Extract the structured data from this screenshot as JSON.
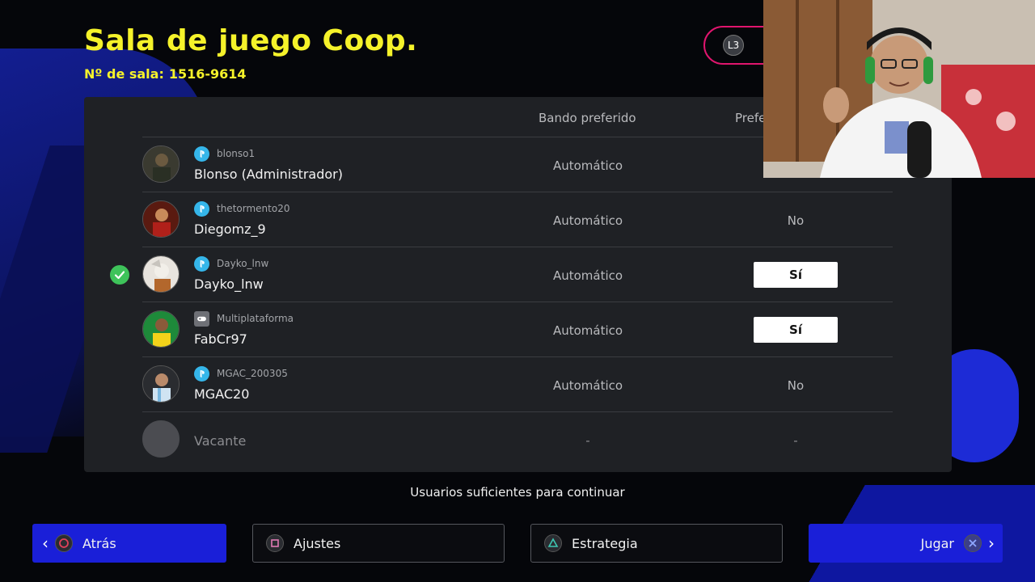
{
  "header": {
    "title": "Sala de juego Coop.",
    "room_label": "Nº de sala:",
    "room_number": "1516-9614",
    "l3_label": "L3"
  },
  "columns": {
    "side": "Bando preferido",
    "pref": "Prefe"
  },
  "players": [
    {
      "platform": "playstation",
      "user_id": "blonso1",
      "name": "Blonso (Administrador)",
      "side": "Automático",
      "pref": ""
    },
    {
      "platform": "playstation",
      "user_id": "thetormento20",
      "name": "Diegomz_9",
      "side": "Automático",
      "pref": "No"
    },
    {
      "platform": "playstation",
      "user_id": "Dayko_lnw",
      "name": "Dayko_lnw",
      "side": "Automático",
      "pref": "Sí"
    },
    {
      "platform": "multi",
      "user_id": "Multiplataforma",
      "name": "FabCr97",
      "side": "Automático",
      "pref": "Sí"
    },
    {
      "platform": "playstation",
      "user_id": "MGAC_200305",
      "name": "MGAC20",
      "side": "Automático",
      "pref": "No"
    },
    {
      "platform": "none",
      "user_id": "",
      "name": "Vacante",
      "side": "-",
      "pref": "-"
    }
  ],
  "status_message": "Usuarios suficientes para continuar",
  "footer": {
    "back": "Atrás",
    "settings": "Ajustes",
    "strategy": "Estrategia",
    "play": "Jugar"
  },
  "colors": {
    "title": "#f5f22a",
    "accent_blue": "#1a1fd8",
    "panel": "#1f2125",
    "check": "#3ec35a",
    "l3_border": "#e0156e"
  }
}
